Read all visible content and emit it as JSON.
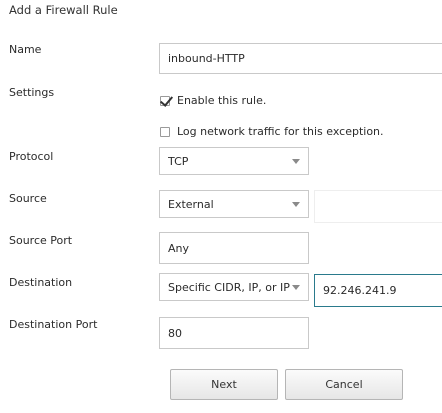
{
  "dialog": {
    "title": "Add a Firewall Rule"
  },
  "labels": {
    "name": "Name",
    "settings": "Settings",
    "protocol": "Protocol",
    "source": "Source",
    "source_port": "Source Port",
    "destination": "Destination",
    "destination_port": "Destination Port"
  },
  "fields": {
    "name_value": "inbound-HTTP",
    "enable_rule_label": "Enable this rule.",
    "enable_rule_checked": true,
    "log_traffic_label": "Log network traffic for this exception.",
    "log_traffic_checked": false,
    "protocol_selected": "TCP",
    "source_selected": "External",
    "source_value": "",
    "source_port_value": "Any",
    "destination_selected": "Specific CIDR, IP, or IP",
    "destination_value": "92.246.241.9",
    "destination_port_value": "80"
  },
  "buttons": {
    "next": "Next",
    "cancel": "Cancel"
  },
  "colors": {
    "focus_border": "#2a7a8c",
    "field_border": "#c9c9c9"
  },
  "icons": {
    "dropdown": "chevron-down-icon",
    "checkmark": "checkmark-icon"
  }
}
